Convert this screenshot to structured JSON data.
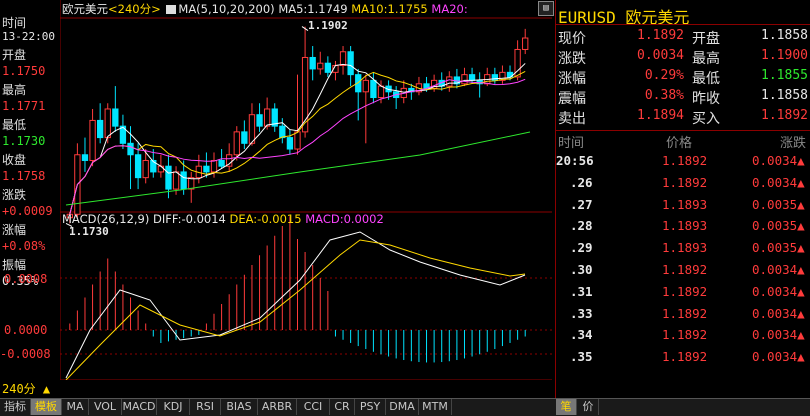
{
  "header": {
    "symbol_name": "欧元美元",
    "period": "<240分>",
    "ma_label": "MA(5,10,20,200)",
    "ma5": "MA5:1.1749",
    "ma10": "MA10:1.1755",
    "ma20": "MA20:"
  },
  "left": {
    "time_label": "时间",
    "time_value": "13-22:00",
    "open_label": "开盘",
    "open_value": "1.1750",
    "high_label": "最高",
    "high_value": "1.1771",
    "low_label": "最低",
    "low_value": "1.1730",
    "close_label": "收盘",
    "close_value": "1.1758",
    "change_label": "涨跌",
    "change_value": "+0.0009",
    "pct_label": "涨幅",
    "pct_value": "+0.08%",
    "amp_label": "振幅",
    "amp_value": "0.35%",
    "period_value": "240分 ▲"
  },
  "chart": {
    "max_label": "1.1902",
    "min_label": "1.1730",
    "macd_title": "MACD(26,12,9)",
    "diff": "DIFF:-0.0014",
    "dea": "DEA:-0.0015",
    "macd": "MACD:0.0002",
    "axis": [
      "0.0008",
      "0.0000",
      "-0.0008"
    ]
  },
  "panel": {
    "title": "EURUSD 欧元美元",
    "quote_rows": [
      {
        "l1": "现价",
        "v1": "1.1892",
        "c1": "#ff3b3b",
        "l2": "开盘",
        "v2": "1.1858",
        "c2": "#e8e8e8"
      },
      {
        "l1": "涨跌",
        "v1": "0.0034",
        "c1": "#ff3b3b",
        "l2": "最高",
        "v2": "1.1900",
        "c2": "#ff3b3b"
      },
      {
        "l1": "涨幅",
        "v1": "0.29%",
        "c1": "#ff3b3b",
        "l2": "最低",
        "v2": "1.1855",
        "c2": "#2ee82e"
      },
      {
        "l1": "震幅",
        "v1": "0.38%",
        "c1": "#ff3b3b",
        "l2": "昨收",
        "v2": "1.1858",
        "c2": "#e8e8e8"
      },
      {
        "l1": "卖出",
        "v1": "1.1894",
        "c1": "#ff3b3b",
        "l2": "买入",
        "v2": "1.1892",
        "c2": "#ff3b3b"
      }
    ],
    "tick_header": {
      "time": "时间",
      "price": "价格",
      "change": "涨跌"
    },
    "ticks": [
      {
        "time": "20:56",
        "price": "1.1892",
        "change": "0.0034▲"
      },
      {
        "time": ".26",
        "price": "1.1892",
        "change": "0.0034▲"
      },
      {
        "time": ".27",
        "price": "1.1893",
        "change": "0.0035▲"
      },
      {
        "time": ".28",
        "price": "1.1893",
        "change": "0.0035▲"
      },
      {
        "time": ".29",
        "price": "1.1893",
        "change": "0.0035▲"
      },
      {
        "time": ".30",
        "price": "1.1892",
        "change": "0.0034▲"
      },
      {
        "time": ".31",
        "price": "1.1892",
        "change": "0.0034▲"
      },
      {
        "time": ".33",
        "price": "1.1892",
        "change": "0.0034▲"
      },
      {
        "time": ".34",
        "price": "1.1892",
        "change": "0.0034▲"
      },
      {
        "time": ".35",
        "price": "1.1892",
        "change": "0.0034▲"
      }
    ],
    "bottom_tabs": [
      "笔",
      "价"
    ]
  },
  "bottom_tabs": [
    "指标",
    "模板",
    "MA",
    "VOL",
    "MACD",
    "KDJ",
    "RSI",
    "BIAS",
    "ARBR",
    "CCI",
    "CR",
    "PSY",
    "DMA",
    "MTM"
  ],
  "active_tab": "模板",
  "colors": {
    "up": "#ff3b3b",
    "down": "#00e5ff",
    "ma5": "#ffffff",
    "ma10": "#ffd800",
    "ma20": "#ff44ff",
    "ma200": "#2ee82e"
  }
}
